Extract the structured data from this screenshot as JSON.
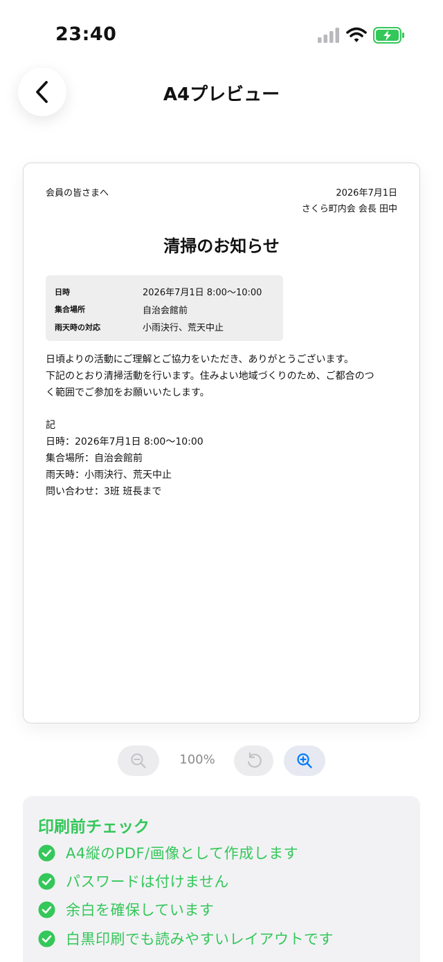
{
  "status_bar": {
    "time": "23:40"
  },
  "header": {
    "title": "A4プレビュー",
    "back_icon": "chevron-left-icon"
  },
  "document": {
    "recipient": "会員の皆さまへ",
    "date": "2026年7月1日",
    "sender": "さくら町内会 会長 田中",
    "title": "清掃のお知らせ",
    "info": [
      {
        "label": "日時",
        "value": "2026年7月1日 8:00〜10:00"
      },
      {
        "label": "集合場所",
        "value": "自治会館前"
      },
      {
        "label": "雨天時の対応",
        "value": "小雨決行、荒天中止"
      }
    ],
    "body_lines": [
      "日頃よりの活動にご理解とご協力をいただき、ありがとうございます。",
      "下記のとおり清掃活動を行います。住みよい地域づくりのため、ご都合のつ",
      "く範囲でご参加をお願いいたします。"
    ],
    "details": [
      "記",
      "日時：2026年7月1日 8:00〜10:00",
      "集合場所：自治会館前",
      "雨天時：小雨決行、荒天中止",
      "問い合わせ：3班 班長まで"
    ]
  },
  "zoom": {
    "level": "100%",
    "icons": [
      "zoom-out-icon",
      "rotate-icon",
      "zoom-in-icon"
    ]
  },
  "checklist": {
    "title": "印刷前チェック",
    "items": [
      "A4縦のPDF/画像として作成します",
      "パスワードは付けません",
      "余白を確保しています",
      "白黒印刷でも読みやすいレイアウトです"
    ]
  },
  "colors": {
    "accent_green": "#34c759",
    "accent_blue": "#007aff",
    "panel_bg": "#f2f2f5"
  }
}
